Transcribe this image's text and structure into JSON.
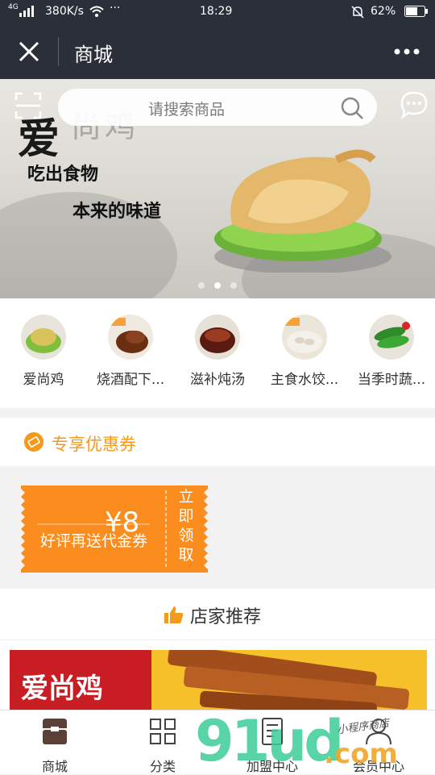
{
  "status_bar": {
    "network": "4G",
    "speed": "380K/s",
    "time": "18:29",
    "battery": "62%"
  },
  "navbar": {
    "title": "商城"
  },
  "banner": {
    "search_placeholder": "请搜索商品",
    "brand_char": "爱",
    "brand_rest": "尚鸡",
    "line1": "吃出食物",
    "line2": "本来的味道",
    "slide_count": 3,
    "active_slide": 2
  },
  "categories": [
    {
      "label": "爱尚鸡",
      "icon": "chicken-dish-image"
    },
    {
      "label": "烧酒配下...",
      "icon": "braised-meat-image"
    },
    {
      "label": "滋补炖汤",
      "icon": "stew-soup-image"
    },
    {
      "label": "主食水饺...",
      "icon": "dumplings-image"
    },
    {
      "label": "当季时蔬...",
      "icon": "vegetables-image"
    }
  ],
  "coupon_section": {
    "title": "专享优惠券",
    "coupon": {
      "amount": "¥8",
      "description": "好评再送代金券",
      "action": "立即领取"
    }
  },
  "recommend": {
    "title": "店家推荐"
  },
  "product": {
    "brand_text": "爱尚鸡"
  },
  "tabbar": [
    {
      "label": "商城",
      "icon": "shop-icon"
    },
    {
      "label": "分类",
      "icon": "grid-icon"
    },
    {
      "label": "加盟中心",
      "icon": "document-icon"
    },
    {
      "label": "会员中心",
      "icon": "user-icon"
    }
  ],
  "watermark": {
    "main": "91ud",
    "suffix": ".com",
    "script": "小程序商店"
  },
  "colors": {
    "header": "#2b2f3a",
    "accent": "#f39a1c",
    "coupon_bg": "#fb8c1e",
    "brand_red": "#c81e23"
  }
}
